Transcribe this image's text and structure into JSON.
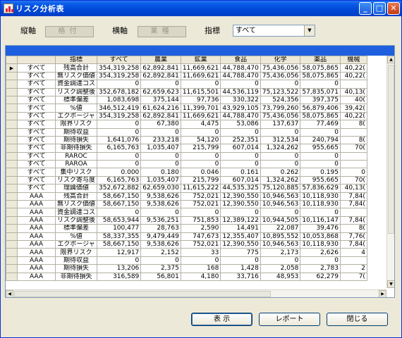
{
  "window": {
    "title": "リスク分析表"
  },
  "titlebar_buttons": {
    "minimize": "_",
    "maximize": "□",
    "close": "✕"
  },
  "filters": {
    "vertical_label": "縦軸",
    "vertical_value": "格付",
    "horizontal_label": "横軸",
    "horizontal_value": "業種",
    "metric_label": "指標",
    "metric_value": "すべて"
  },
  "grid": {
    "headers": [
      "",
      "",
      "指標",
      "すべて",
      "農業",
      "鉱業",
      "食品",
      "化学",
      "薬品",
      "機械"
    ],
    "rows": [
      [
        "▶",
        "すべて",
        "残高合計",
        "354,319,258",
        "62,892,841",
        "11,669,621",
        "44,788,470",
        "75,436,056",
        "58,075,865",
        "40,22("
      ],
      [
        "",
        "すべて",
        "無リスク価値",
        "354,319,258",
        "62,892,841",
        "11,669,621",
        "44,788,470",
        "75,436,056",
        "58,075,865",
        "40,22("
      ],
      [
        "",
        "すべて",
        "資金調達コス",
        "0",
        "0",
        "0",
        "0",
        "0",
        "0",
        ""
      ],
      [
        "",
        "すべて",
        "リスク調整後",
        "352,678,182",
        "62,659,623",
        "11,615,501",
        "44,536,119",
        "75,123,522",
        "57,835,071",
        "40,13("
      ],
      [
        "",
        "すべて",
        "標準偏差",
        "1,083,698",
        "375,144",
        "97,736",
        "330,322",
        "524,356",
        "397,375",
        "40("
      ],
      [
        "",
        "すべて",
        "%値",
        "346,512,419",
        "61,624,216",
        "11,399,701",
        "43,929,105",
        "73,799,260",
        "56,879,406",
        "39,42("
      ],
      [
        "",
        "すべて",
        "エクポージャ",
        "354,319,258",
        "62,892,841",
        "11,669,621",
        "44,788,470",
        "75,436,056",
        "58,075,865",
        "40,22("
      ],
      [
        "",
        "すべて",
        "限界リスク",
        "0",
        "67,380",
        "4,475",
        "53,086",
        "137,637",
        "77,469",
        "8("
      ],
      [
        "",
        "すべて",
        "期待収益",
        "0",
        "0",
        "0",
        "0",
        "0",
        "0",
        ""
      ],
      [
        "",
        "すべて",
        "期待損失",
        "1,641,076",
        "233,218",
        "54,120",
        "252,351",
        "312,534",
        "240,794",
        "8("
      ],
      [
        "",
        "すべて",
        "非期待損失",
        "6,165,763",
        "1,035,407",
        "215,799",
        "607,014",
        "1,324,262",
        "955,665",
        "70("
      ],
      [
        "",
        "すべて",
        "RAROC",
        "0",
        "0",
        "0",
        "0",
        "0",
        "0",
        ""
      ],
      [
        "",
        "すべて",
        "RAROA",
        "0",
        "0",
        "0",
        "0",
        "0",
        "0",
        ""
      ],
      [
        "",
        "すべて",
        "集中リスク",
        "0.000",
        "0.180",
        "0.046",
        "0.161",
        "0.262",
        "0.195",
        "0"
      ],
      [
        "",
        "すべて",
        "リスク寄与度",
        "6,165,763",
        "1,035,407",
        "215,799",
        "607,014",
        "1,324,262",
        "955,665",
        "70("
      ],
      [
        "",
        "すべて",
        "理論価値",
        "352,672,882",
        "62,659,030",
        "11,615,222",
        "44,535,325",
        "75,120,885",
        "57,836,629",
        "40,13("
      ],
      [
        "",
        "AAA",
        "残高合計",
        "58,667,150",
        "9,538,626",
        "752,021",
        "12,390,550",
        "10,946,563",
        "10,118,930",
        "7,84("
      ],
      [
        "",
        "AAA",
        "無リスク価値",
        "58,667,150",
        "9,538,626",
        "752,021",
        "12,390,550",
        "10,946,563",
        "10,118,930",
        "7,84("
      ],
      [
        "",
        "AAA",
        "資金調達コス",
        "0",
        "0",
        "0",
        "0",
        "0",
        "0",
        ""
      ],
      [
        "",
        "AAA",
        "リスク調整後",
        "58,653,944",
        "9,536,251",
        "751,853",
        "12,389,122",
        "10,944,505",
        "10,116,147",
        "7,84("
      ],
      [
        "",
        "AAA",
        "標準偏差",
        "100,477",
        "28,763",
        "2,590",
        "14,491",
        "22,087",
        "39,476",
        "8("
      ],
      [
        "",
        "AAA",
        "%値",
        "58,337,355",
        "9,479,449",
        "747,673",
        "12,355,407",
        "10,895,552",
        "10,053,868",
        "7,76("
      ],
      [
        "",
        "AAA",
        "エクポージャ",
        "58,667,150",
        "9,538,626",
        "752,021",
        "12,390,550",
        "10,946,563",
        "10,118,930",
        "7,84("
      ],
      [
        "",
        "AAA",
        "限界リスク",
        "12,917",
        "2,152",
        "33",
        "775",
        "2,173",
        "2,626",
        "4"
      ],
      [
        "",
        "AAA",
        "期待収益",
        "0",
        "0",
        "0",
        "0",
        "0",
        "0",
        ""
      ],
      [
        "",
        "AAA",
        "期待損失",
        "13,206",
        "2,375",
        "168",
        "1,428",
        "2,058",
        "2,783",
        "2"
      ],
      [
        "",
        "AAA",
        "非期待損失",
        "316,589",
        "56,801",
        "4,180",
        "33,716",
        "48,953",
        "62,279",
        "7("
      ]
    ]
  },
  "scroll": {
    "up": "▲",
    "down": "▼",
    "left": "◀",
    "right": "▶"
  },
  "buttons": {
    "display": "表 示",
    "report": "レポート",
    "close": "閉じる"
  }
}
